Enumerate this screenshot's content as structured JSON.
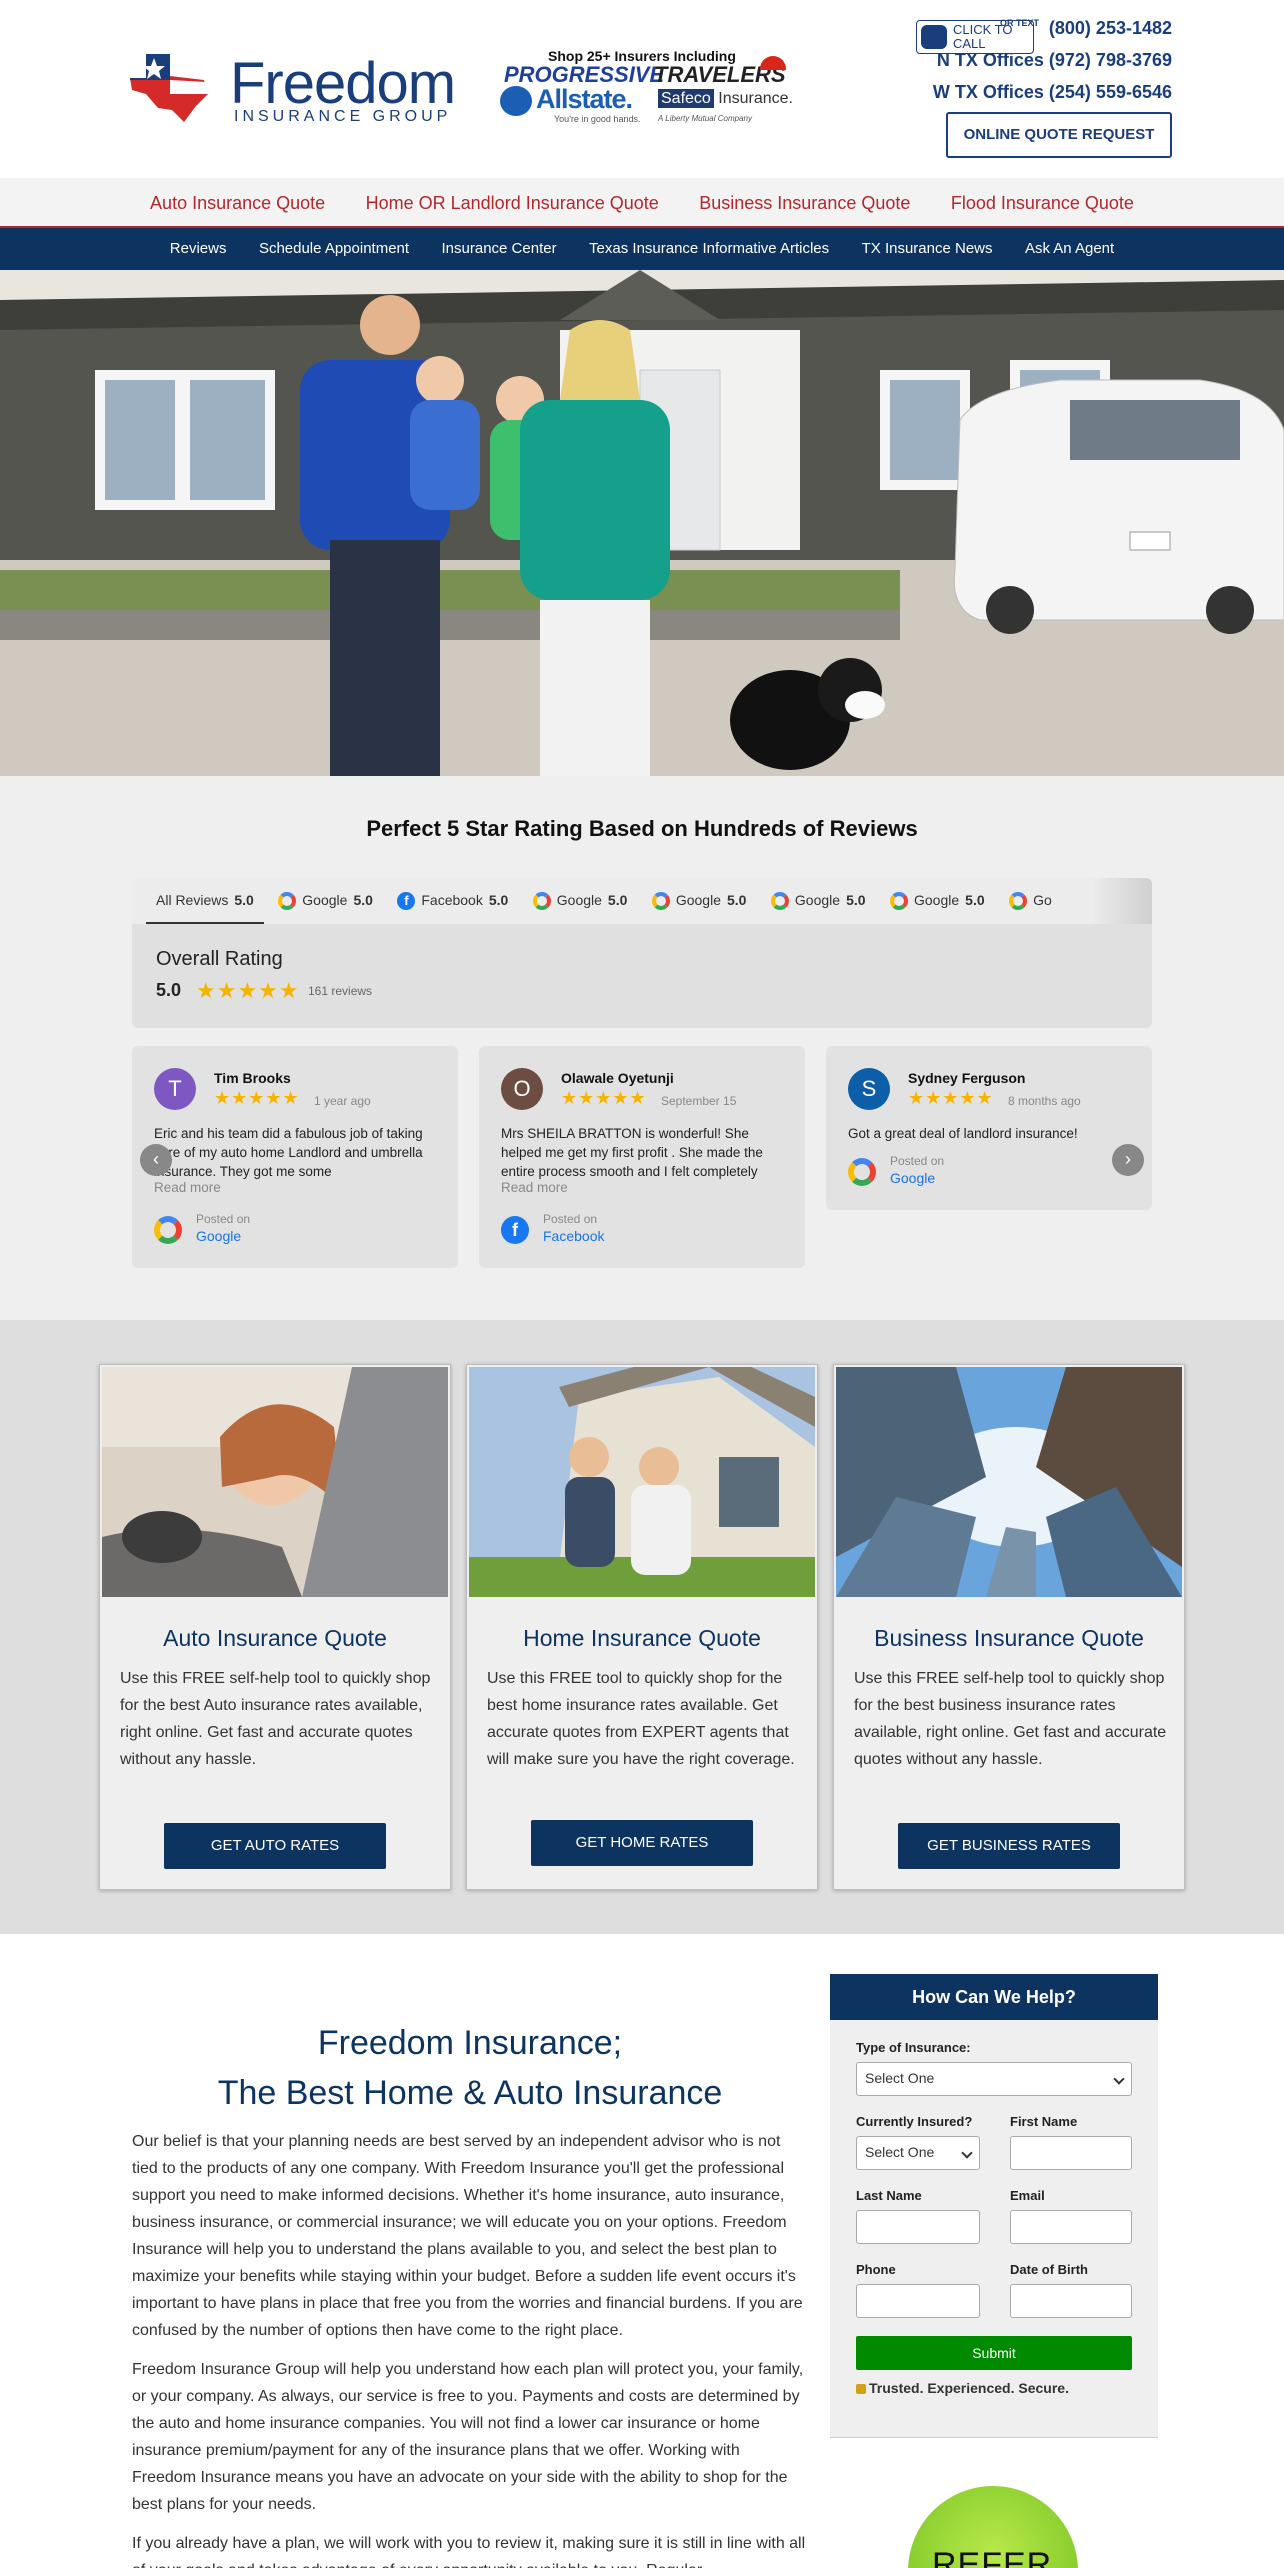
{
  "header": {
    "logo_word": "Freedom",
    "logo_sub": "INSURANCE GROUP",
    "insurers_tagline": "Shop 25+ Insurers Including",
    "insurers": [
      "PROGRESSIVE",
      "TRAVELERS",
      "Allstate.",
      "Safeco Insurance."
    ],
    "allstate_tag": "You're in good hands.",
    "safeco_tag": "A Liberty Mutual Company",
    "click_to_call": "CLICK TO CALL",
    "or_text": "OR TEXT",
    "phone_main": "(800) 253-1482",
    "office_n_label": "N TX Offices",
    "office_n_phone": "(972) 798-3769",
    "office_w_label": "W TX Offices",
    "office_w_phone": "(254) 559-6546",
    "quote_button": "ONLINE QUOTE REQUEST"
  },
  "nav_primary": [
    "Auto Insurance Quote",
    "Home OR Landlord Insurance Quote",
    "Business Insurance Quote",
    "Flood Insurance Quote"
  ],
  "nav_secondary": [
    "Reviews",
    "Schedule Appointment",
    "Insurance Center",
    "Texas Insurance Informative Articles",
    "TX Insurance News",
    "Ask An Agent"
  ],
  "reviews": {
    "title": "Perfect 5 Star Rating Based on Hundreds of Reviews",
    "tabs": [
      {
        "label": "All Reviews",
        "score": "5.0",
        "icon": "none"
      },
      {
        "label": "Google",
        "score": "5.0",
        "icon": "google"
      },
      {
        "label": "Facebook",
        "score": "5.0",
        "icon": "facebook"
      },
      {
        "label": "Google",
        "score": "5.0",
        "icon": "google"
      },
      {
        "label": "Google",
        "score": "5.0",
        "icon": "google"
      },
      {
        "label": "Google",
        "score": "5.0",
        "icon": "google"
      },
      {
        "label": "Google",
        "score": "5.0",
        "icon": "google"
      },
      {
        "label": "Go",
        "score": "",
        "icon": "google"
      }
    ],
    "overall_label": "Overall Rating",
    "overall_score": "5.0",
    "overall_stars": "★★★★★",
    "overall_count": "161 reviews",
    "cards": [
      {
        "initial": "T",
        "avatar_color": "#7e57c2",
        "name": "Tim Brooks",
        "stars": "★★★★★",
        "date": "1 year ago",
        "text": "Eric and his team did a fabulous job of taking care of my auto home Landlord and umbrella insurance. They got me some",
        "more": "Read more",
        "posted_on": "Posted on",
        "source": "Google",
        "source_icon": "google"
      },
      {
        "initial": "O",
        "avatar_color": "#6d4c41",
        "name": "Olawale Oyetunji",
        "stars": "★★★★★",
        "date": "September 15",
        "text": "Mrs SHEILA BRATTON is wonderful! She helped me get my first profit . She made the entire process smooth and I felt completely",
        "more": "Read more",
        "posted_on": "Posted on",
        "source": "Facebook",
        "source_icon": "facebook"
      },
      {
        "initial": "S",
        "avatar_color": "#0d5ea8",
        "name": "Sydney Ferguson",
        "stars": "★★★★★",
        "date": "8 months ago",
        "text": "Got a great deal of landlord insurance!",
        "more": "",
        "posted_on": "Posted on",
        "source": "Google",
        "source_icon": "google"
      }
    ],
    "prev_arrow": "‹",
    "next_arrow": "›"
  },
  "services": [
    {
      "title": "Auto Insurance Quote",
      "text": "Use this FREE self-help tool to quickly shop for the best Auto insurance rates available, right online. Get fast and accurate quotes without any hassle.",
      "button": "GET AUTO RATES"
    },
    {
      "title": "Home Insurance Quote",
      "text": "Use this FREE tool to quickly shop for the best home insurance rates available. Get accurate quotes from EXPERT agents that will make sure you have the right coverage.",
      "button": "GET HOME RATES"
    },
    {
      "title": "Business Insurance Quote",
      "text": "Use this FREE self-help tool to quickly shop for the best business insurance rates available, right online. Get fast and accurate quotes without any hassle.",
      "button": "GET BUSINESS RATES"
    }
  ],
  "about": {
    "title_line1": "Freedom Insurance;",
    "title_line2": "The Best Home & Auto Insurance",
    "paragraphs": [
      "Our belief is that your planning needs are best served by an independent advisor who is not tied to the products of any one company. With Freedom Insurance you'll get the professional support you need to make informed decisions. Whether it's home insurance, auto insurance, business insurance, or commercial insurance; we will educate you on your options. Freedom Insurance will help you to understand the plans available to you, and select the best plan to maximize your benefits while staying within your budget. Before a sudden life event occurs it's important to have plans in place that free you from the worries and financial burdens. If you are confused by the number of options then have come to the right place.",
      "Freedom Insurance Group will help you understand how each plan will protect you, your family, or your company. As always, our service is free to you. Payments and costs are determined by the auto and home insurance companies. You will not find a lower car insurance or home insurance premium/payment for any of the insurance plans that we offer. Working with Freedom Insurance means you have an advocate on your side with the ability to shop for the best plans for your needs.",
      "If you already have a plan, we will work with you to review it, making sure it is still in line with all of your goals and takes advantage of every opportunity available to you. Regular"
    ]
  },
  "help_form": {
    "heading": "How Can We Help?",
    "type_label": "Type of Insurance:",
    "type_value": "Select One",
    "insured_label": "Currently Insured?",
    "insured_value": "Select One",
    "first_name_label": "First Name",
    "last_name_label": "Last Name",
    "email_label": "Email",
    "phone_label": "Phone",
    "dob_label": "Date of Birth",
    "submit": "Submit",
    "trust": "Trusted. Experienced. Secure."
  },
  "refer_badge": "REFER A"
}
